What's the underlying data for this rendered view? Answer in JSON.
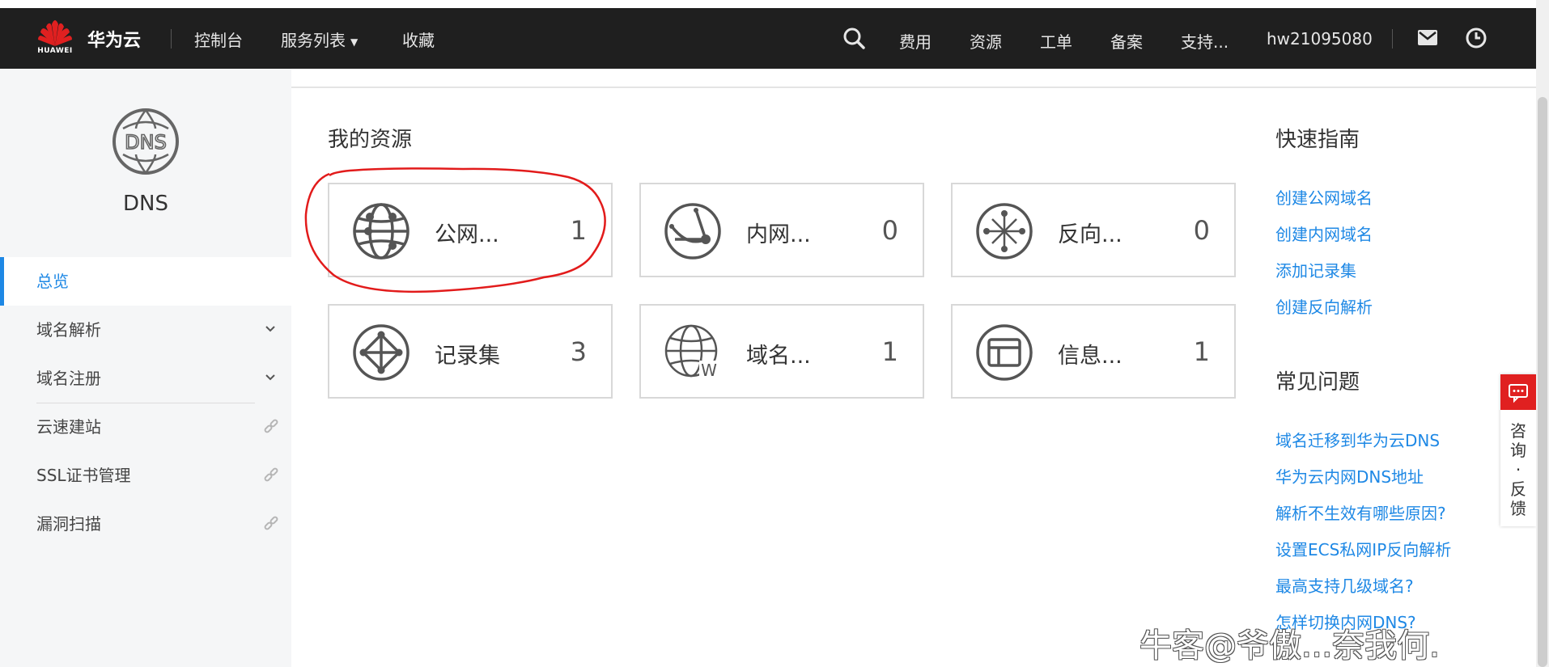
{
  "topbar": {
    "logo_text": "HUAWEI",
    "brand": "华为云",
    "nav": [
      "控制台",
      "服务列表",
      "收藏"
    ],
    "right": [
      "费用",
      "资源",
      "工单",
      "备案",
      "支持..."
    ],
    "user": "hw21095080"
  },
  "sidebar": {
    "service_title": "DNS",
    "items": [
      {
        "label": "总览"
      },
      {
        "label": "域名解析"
      },
      {
        "label": "域名注册"
      },
      {
        "label": "云速建站"
      },
      {
        "label": "SSL证书管理"
      },
      {
        "label": "漏洞扫描"
      }
    ]
  },
  "main": {
    "resources_title": "我的资源",
    "cards": [
      {
        "label": "公网...",
        "count": "1",
        "icon": "globe-icon"
      },
      {
        "label": "内网...",
        "count": "0",
        "icon": "private-network-icon"
      },
      {
        "label": "反向...",
        "count": "0",
        "icon": "reverse-resolution-icon"
      },
      {
        "label": "记录集",
        "count": "3",
        "icon": "record-set-icon"
      },
      {
        "label": "域名...",
        "count": "1",
        "icon": "domain-web-icon"
      },
      {
        "label": "信息...",
        "count": "1",
        "icon": "info-window-icon"
      }
    ]
  },
  "guide": {
    "quick_title": "快速指南",
    "quick_links": [
      "创建公网域名",
      "创建内网域名",
      "添加记录集",
      "创建反向解析"
    ],
    "faq_title": "常见问题",
    "faq_links": [
      "域名迁移到华为云DNS",
      "华为云内网DNS地址",
      "解析不生效有哪些原因?",
      "设置ECS私网IP反向解析",
      "最高支持几级域名?",
      "怎样切换内网DNS?"
    ]
  },
  "feedback": {
    "text": "咨询·反馈"
  },
  "watermark": "牛客@爷傲...奈我何.",
  "colors": {
    "topbar": "#1f1f1f",
    "accent": "#1e88e5",
    "brand_red": "#e02020",
    "sidebar_bg": "#f5f6f7"
  }
}
